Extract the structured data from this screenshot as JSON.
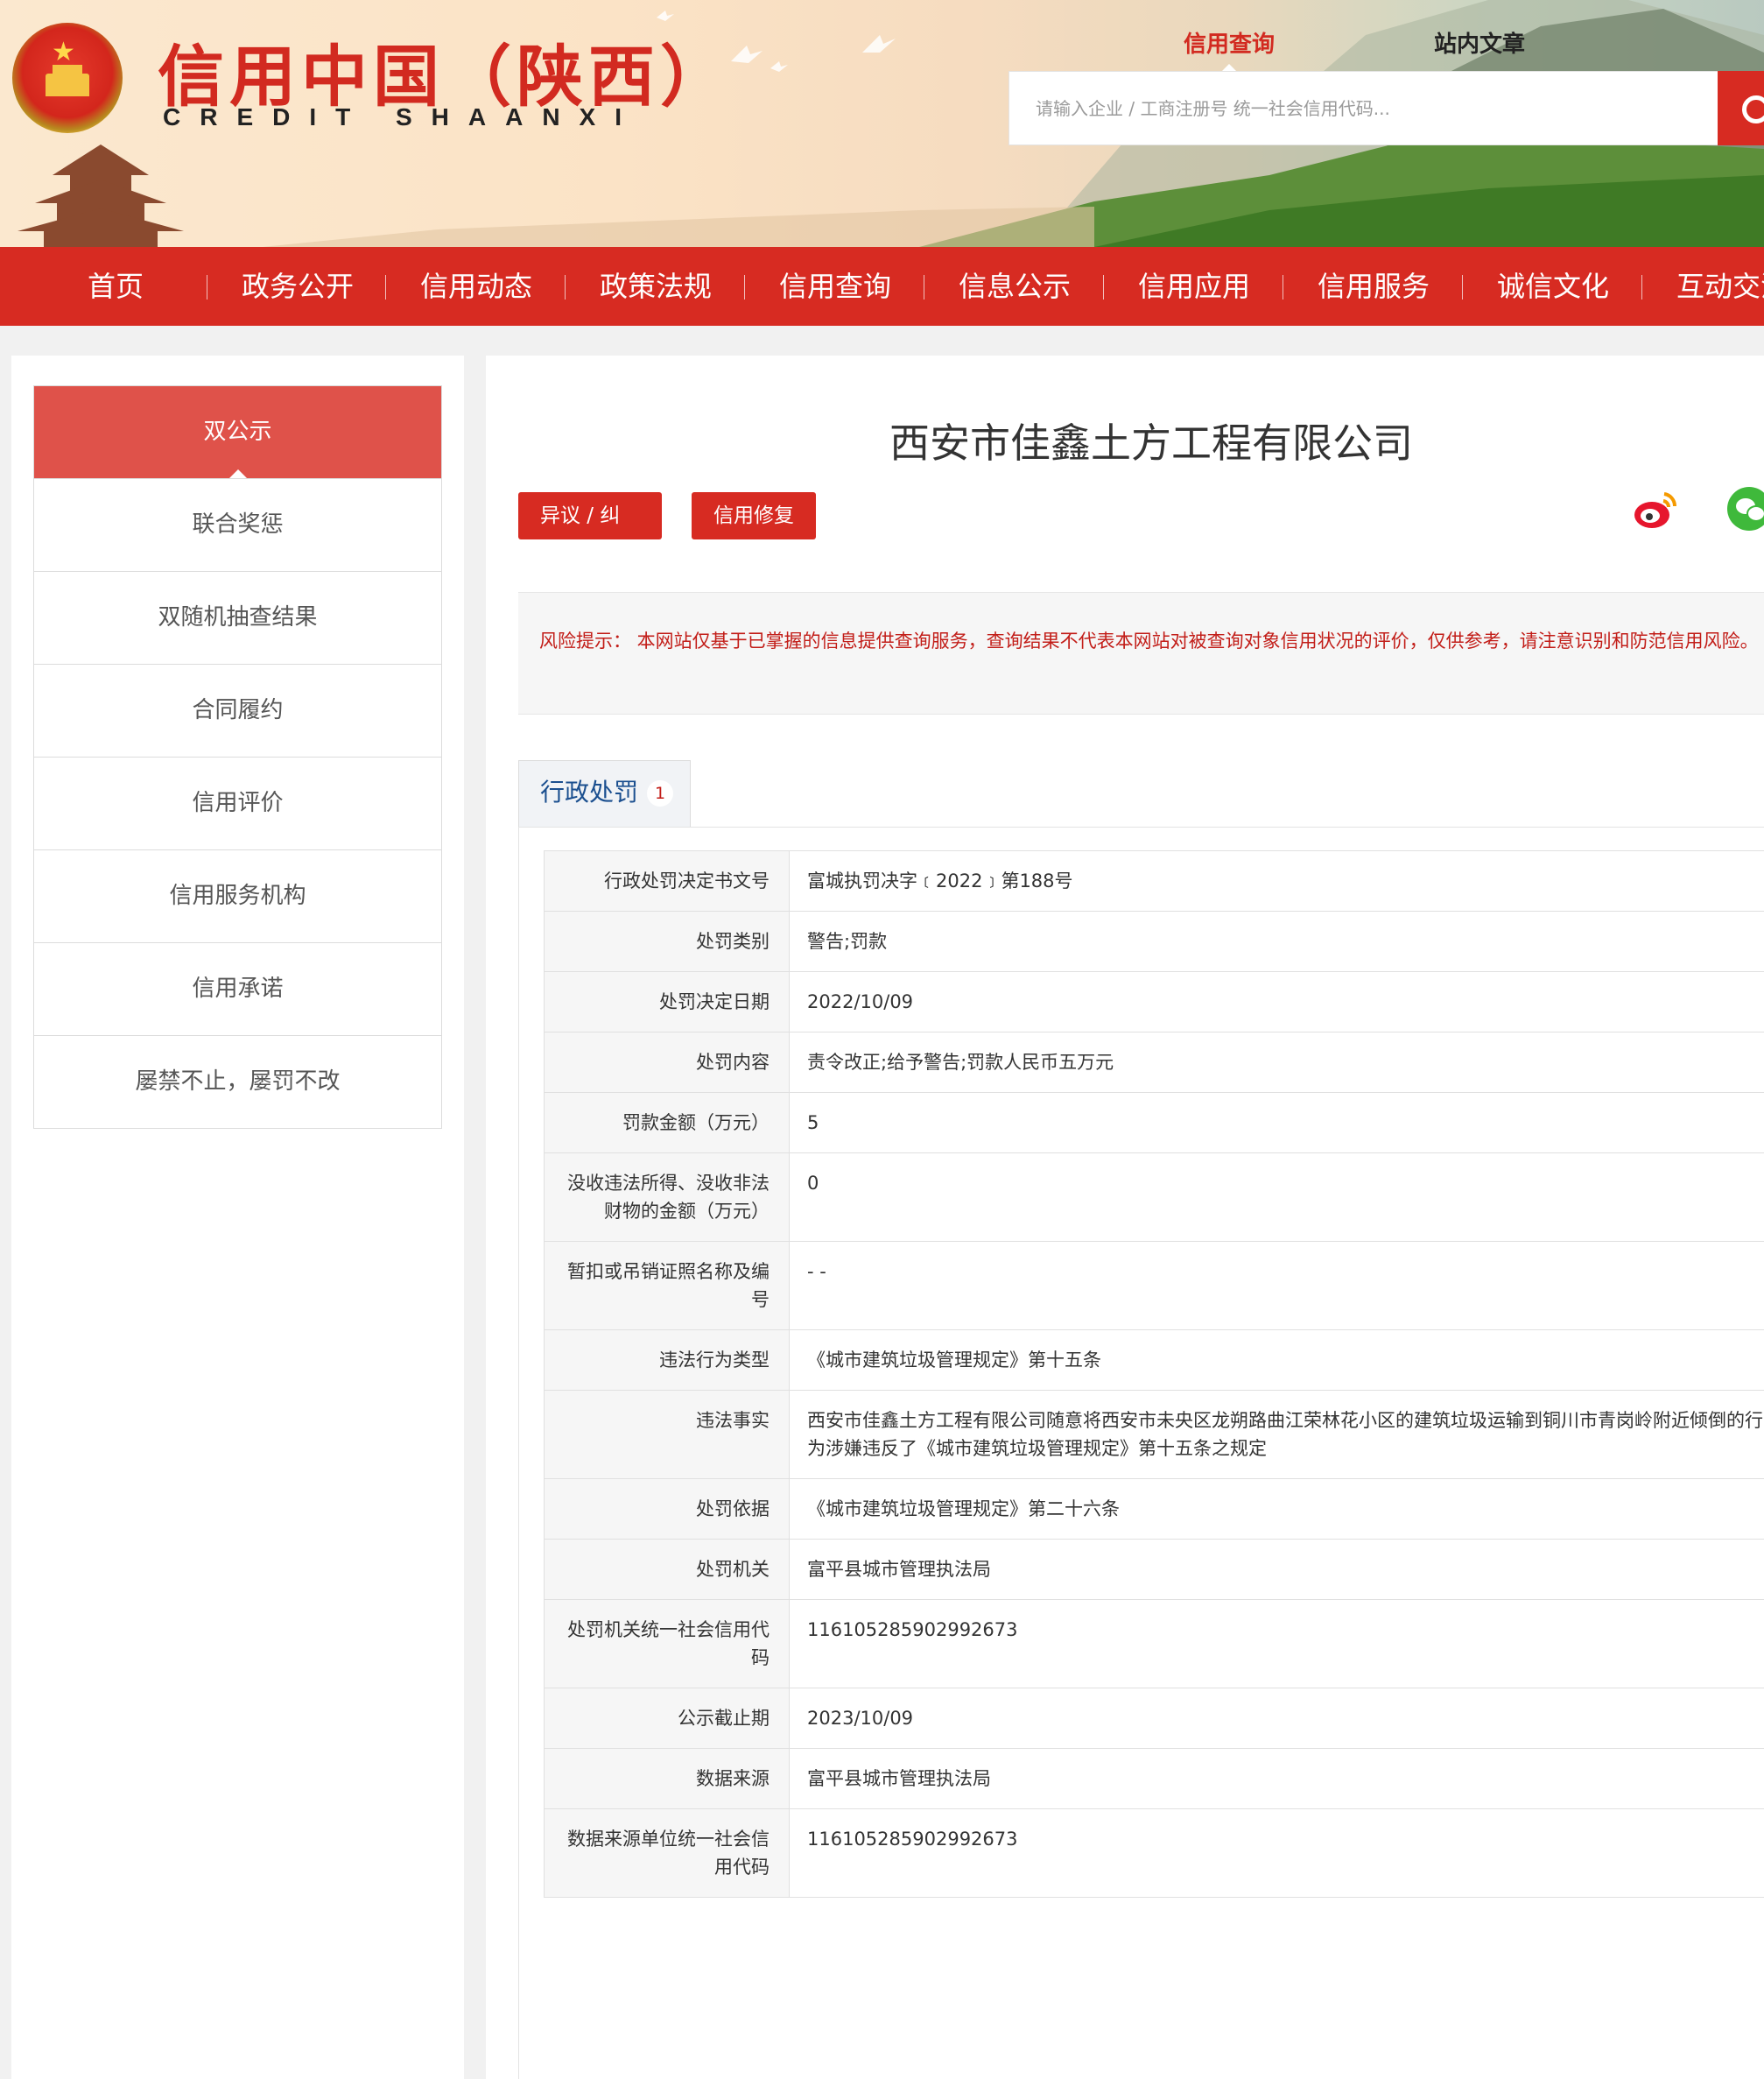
{
  "header": {
    "logo_title": "信用中国（陕西）",
    "logo_subtitle": "CREDIT SHAANXI",
    "tab_credit_query": "信用查询",
    "tab_site_articles": "站内文章",
    "search_placeholder": "请输入企业 / 工商注册号 统一社会信用代码..."
  },
  "nav": [
    "首页",
    "政务公开",
    "信用动态",
    "政策法规",
    "信用查询",
    "信息公示",
    "信用应用",
    "信用服务",
    "诚信文化",
    "互动交流"
  ],
  "sidebar": {
    "items": [
      "双公示",
      "联合奖惩",
      "双随机抽查结果",
      "合同履约",
      "信用评价",
      "信用服务机构",
      "信用承诺",
      "屡禁不止，屡罚不改"
    ],
    "active_index": 0
  },
  "main": {
    "company_name": "西安市佳鑫土方工程有限公司",
    "btn_objection": "异议 / 纠错",
    "btn_repair": "信用修复",
    "risk_label": "风险提示：",
    "risk_text": " 本网站仅基于已掌握的信息提供查询服务，查询结果不代表本网站对被查询对象信用状况的评价，仅供参考，请注意识别和防范信用风险。",
    "tab_label": "行政处罚",
    "tab_count": "1"
  },
  "penalty_rows": [
    {
      "label": "行政处罚决定书文号",
      "value": "富城执罚决字﹝2022﹞第188号"
    },
    {
      "label": "处罚类别",
      "value": "警告;罚款"
    },
    {
      "label": "处罚决定日期",
      "value": "2022/10/09"
    },
    {
      "label": "处罚内容",
      "value": "责令改正;给予警告;罚款人民币五万元"
    },
    {
      "label": "罚款金额（万元）",
      "value": "5"
    },
    {
      "label": "没收违法所得、没收非法财物的金额（万元）",
      "value": "0"
    },
    {
      "label": "暂扣或吊销证照名称及编号",
      "value": "- -"
    },
    {
      "label": "违法行为类型",
      "value": "《城市建筑垃圾管理规定》第十五条"
    },
    {
      "label": "违法事实",
      "value": "西安市佳鑫土方工程有限公司随意将西安市未央区龙朔路曲江荣林花小区的建筑垃圾运输到铜川市青岗岭附近倾倒的行为涉嫌违反了《城市建筑垃圾管理规定》第十五条之规定"
    },
    {
      "label": "处罚依据",
      "value": "《城市建筑垃圾管理规定》第二十六条"
    },
    {
      "label": "处罚机关",
      "value": "富平县城市管理执法局"
    },
    {
      "label": "处罚机关统一社会信用代码",
      "value": "116105285902992673"
    },
    {
      "label": "公示截止期",
      "value": "2023/10/09"
    },
    {
      "label": "数据来源",
      "value": "富平县城市管理执法局"
    },
    {
      "label": "数据来源单位统一社会信用代码",
      "value": "116105285902992673"
    }
  ]
}
